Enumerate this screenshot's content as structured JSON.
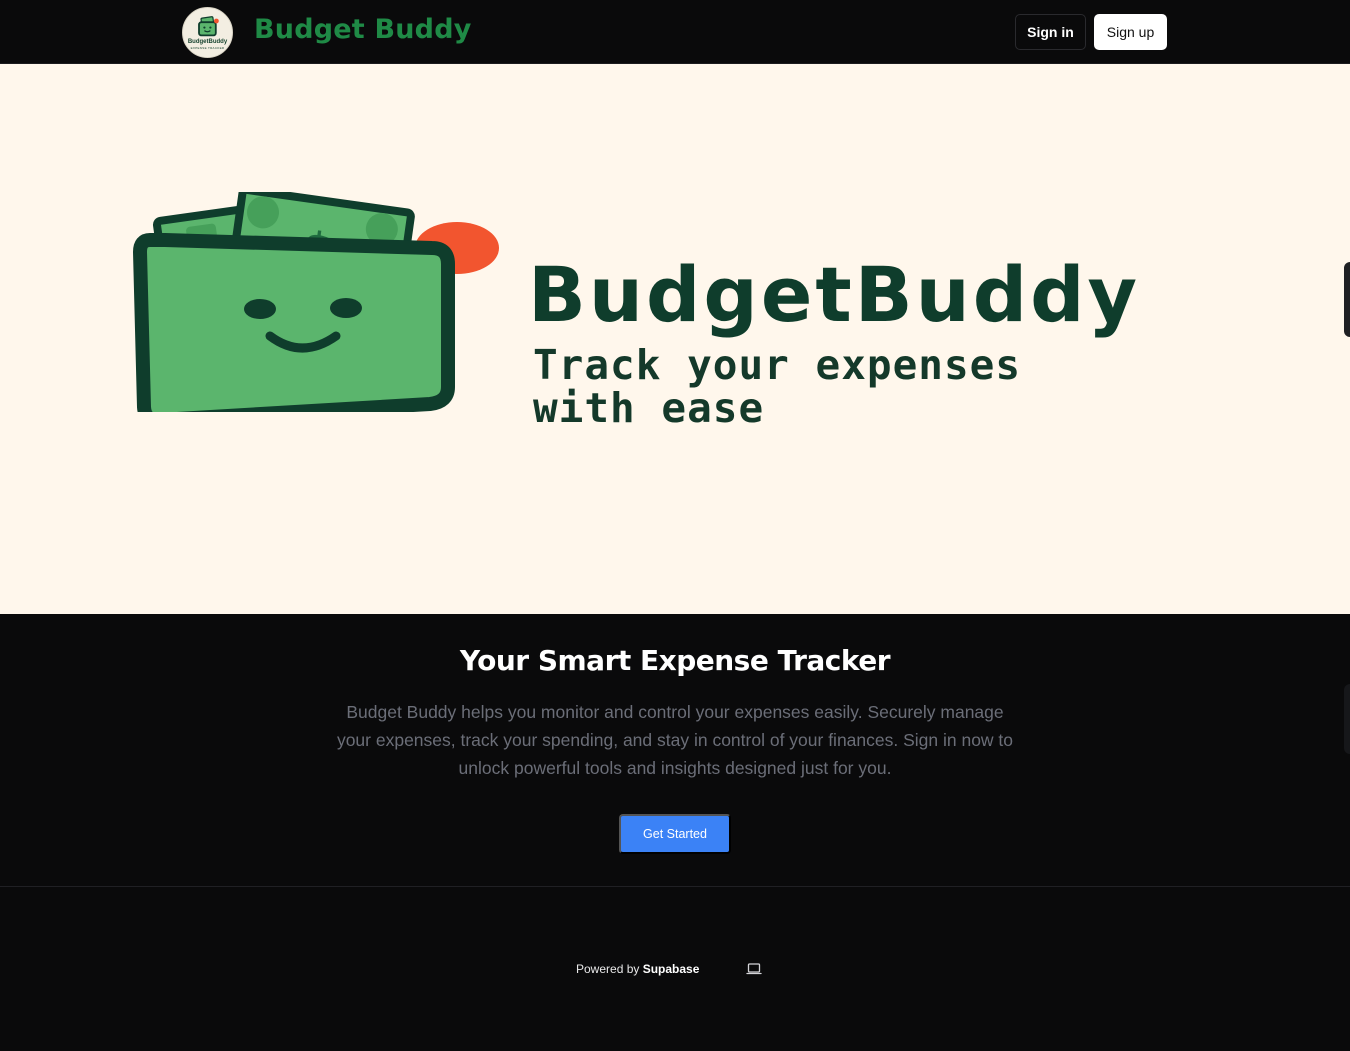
{
  "header": {
    "logo_text": "BudgetBuddy",
    "logo_subtext": "EXPENSE TRACKER",
    "brand": "Budget Buddy",
    "signin_label": "Sign in",
    "signup_label": "Sign up"
  },
  "hero": {
    "logo_icon": "wallet-with-cash-icon",
    "title": "BudgetBuddy",
    "tagline_line1": "Track your expenses",
    "tagline_line2": "with ease"
  },
  "main": {
    "title": "Your Smart Expense Tracker",
    "description": "Budget Buddy helps you monitor and control your expenses easily. Securely manage your expenses, track your spending, and stay in control of your finances. Sign in now to unlock powerful tools and insights designed just for you.",
    "cta_label": "Get Started"
  },
  "footer": {
    "powered_prefix": "Powered by",
    "powered_brand": "Supabase",
    "theme_icon": "laptop-icon"
  },
  "colors": {
    "brand_green": "#1f8a46",
    "dark_green": "#0f3d2c",
    "wallet_green": "#5bb56d",
    "accent_orange": "#f2552f",
    "cta_blue": "#3b82f6",
    "hero_bg": "#fff7ec",
    "page_bg": "#0a0a0b"
  }
}
